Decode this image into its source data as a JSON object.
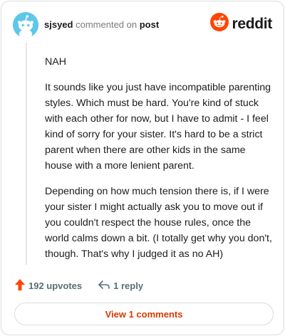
{
  "header": {
    "username": "sjsyed",
    "action_text": "commented on",
    "post_link": "post",
    "brand_name": "reddit"
  },
  "comment": {
    "paragraphs": [
      "NAH",
      "It sounds like you just have incompatible parenting styles. Which must be hard. You're kind of stuck with each other for now, but I have to admit - I feel kind of sorry for your sister. It's hard to be a strict parent when there are other kids in the same house with a more lenient parent.",
      "Depending on how much tension there is, if I were your sister I might actually ask you to move out if you couldn't respect the house rules, once the world calms down a bit. (I totally get why you don't, though. That's why I judged it as no AH)"
    ]
  },
  "actions": {
    "upvotes_label": "192 upvotes",
    "reply_label": "1 reply"
  },
  "footer": {
    "view_comments_label": "View 1 comments"
  },
  "colors": {
    "reddit_orange": "#ff4500",
    "avatar_bg": "#5fc7e8",
    "link_color": "#d93a00",
    "muted_text": "#787c7e"
  },
  "icons": [
    "snoo-avatar-icon",
    "reddit-logo-icon",
    "upvote-arrow-icon",
    "reply-arrow-icon"
  ]
}
